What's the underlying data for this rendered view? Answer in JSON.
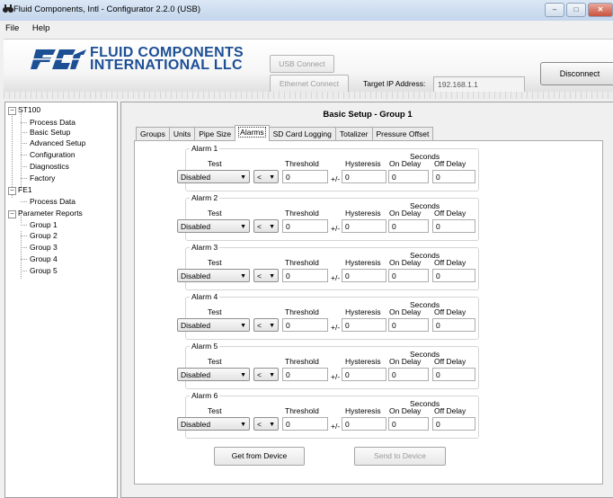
{
  "window": {
    "title": "Fluid Components, Intl - Configurator 2.2.0 (USB)",
    "minimize": "–",
    "maximize": "□",
    "close": "✕"
  },
  "menu": {
    "file": "File",
    "help": "Help"
  },
  "header": {
    "logo_line1": "FLUID COMPONENTS",
    "logo_line2": "INTERNATIONAL LLC",
    "usb_connect": "USB Connect",
    "ethernet_connect": "Ethernet Connect",
    "target_ip_label": "Target IP Address:",
    "target_ip_value": "192.168.1.1",
    "disconnect": "Disconnect"
  },
  "tree": {
    "st100": "ST100",
    "process_data": "Process Data",
    "basic_setup": "Basic Setup",
    "advanced_setup": "Advanced Setup",
    "configuration": "Configuration",
    "diagnostics": "Diagnostics",
    "factory": "Factory",
    "fe1": "FE1",
    "fe1_process_data": "Process Data",
    "parameter_reports": "Parameter Reports",
    "group1": "Group 1",
    "group2": "Group 2",
    "group3": "Group 3",
    "group4": "Group 4",
    "group5": "Group 5",
    "expanded_sign": "−"
  },
  "content": {
    "title": "Basic Setup - Group 1",
    "tabs": [
      "Groups",
      "Units",
      "Pipe Size",
      "Alarms",
      "SD Card Logging",
      "Totalizer",
      "Pressure Offset"
    ],
    "active_tab": "Alarms",
    "headers": {
      "test": "Test",
      "threshold": "Threshold",
      "hysteresis": "Hysteresis",
      "seconds": "Seconds",
      "on_delay": "On Delay",
      "off_delay": "Off Delay",
      "plusminus": "+/-"
    },
    "dropdown_arrow": "▼",
    "alarms": [
      {
        "name": "Alarm 1",
        "test": "Disabled",
        "op": "<",
        "threshold": "0",
        "hysteresis": "0",
        "on_delay": "0",
        "off_delay": "0"
      },
      {
        "name": "Alarm 2",
        "test": "Disabled",
        "op": "<",
        "threshold": "0",
        "hysteresis": "0",
        "on_delay": "0",
        "off_delay": "0"
      },
      {
        "name": "Alarm 3",
        "test": "Disabled",
        "op": "<",
        "threshold": "0",
        "hysteresis": "0",
        "on_delay": "0",
        "off_delay": "0"
      },
      {
        "name": "Alarm 4",
        "test": "Disabled",
        "op": "<",
        "threshold": "0",
        "hysteresis": "0",
        "on_delay": "0",
        "off_delay": "0"
      },
      {
        "name": "Alarm 5",
        "test": "Disabled",
        "op": "<",
        "threshold": "0",
        "hysteresis": "0",
        "on_delay": "0",
        "off_delay": "0"
      },
      {
        "name": "Alarm 6",
        "test": "Disabled",
        "op": "<",
        "threshold": "0",
        "hysteresis": "0",
        "on_delay": "0",
        "off_delay": "0"
      }
    ],
    "get_from_device": "Get from Device",
    "send_to_device": "Send to Device"
  }
}
